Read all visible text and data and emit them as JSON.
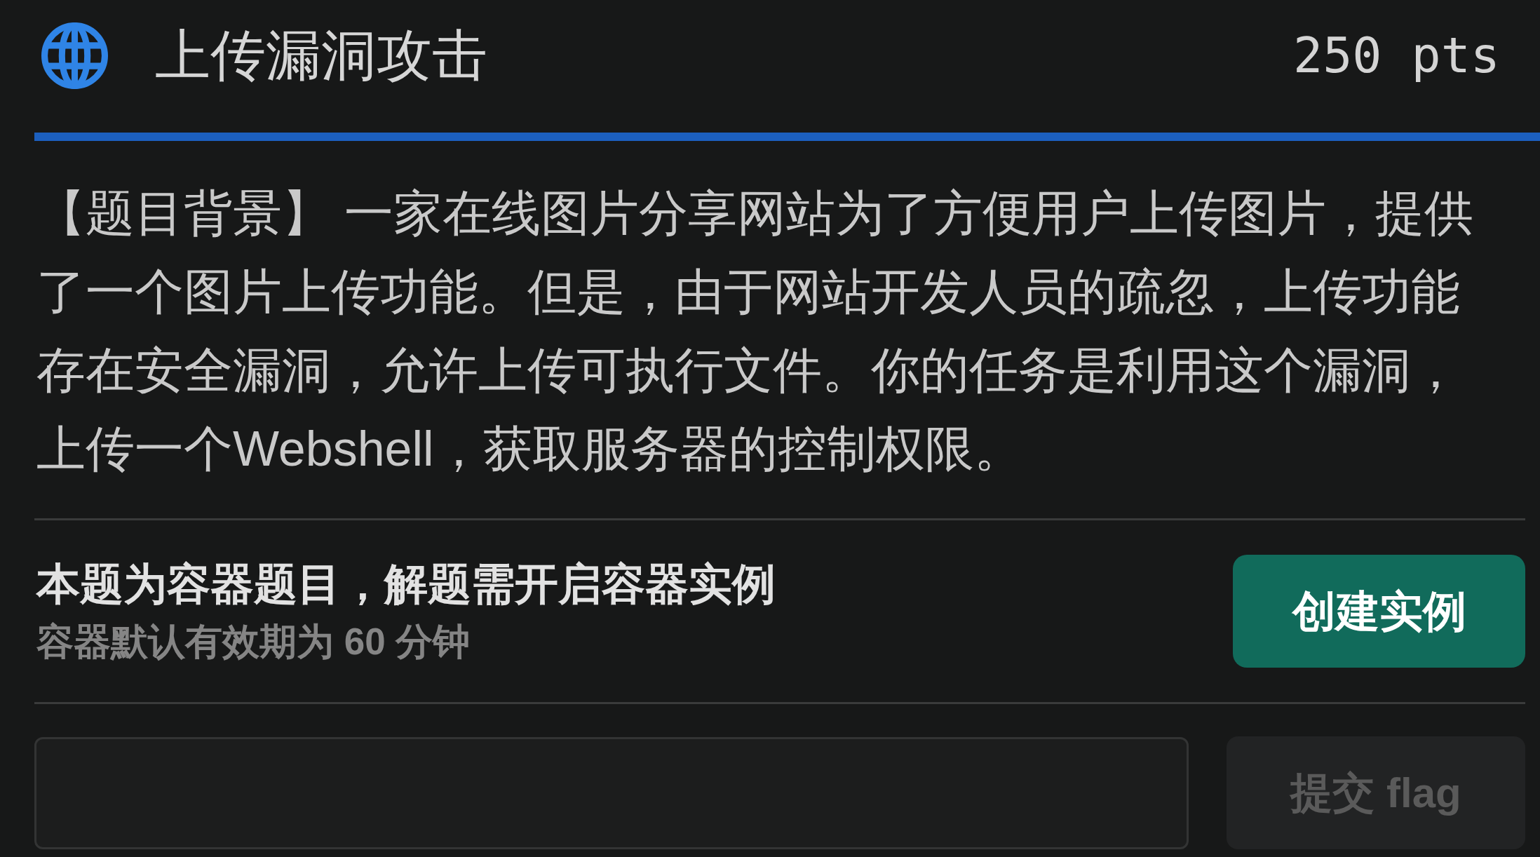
{
  "header": {
    "title": "上传漏洞攻击",
    "points": "250 pts"
  },
  "description": "【题目背景】 一家在线图片分享网站为了方便用户上传图片，提供了一个图片上传功能。但是，由于网站开发人员的疏忽，上传功能存在安全漏洞，允许上传可执行文件。你的任务是利用这个漏洞，上传一个Webshell，获取服务器的控制权限。",
  "container": {
    "title": "本题为容器题目，解题需开启容器实例",
    "note": "容器默认有效期为 60 分钟",
    "button": {
      "label": "创建实例",
      "disabled": false
    }
  },
  "flag_form": {
    "submit": {
      "label": "提交 flag",
      "disabled": true
    }
  }
}
